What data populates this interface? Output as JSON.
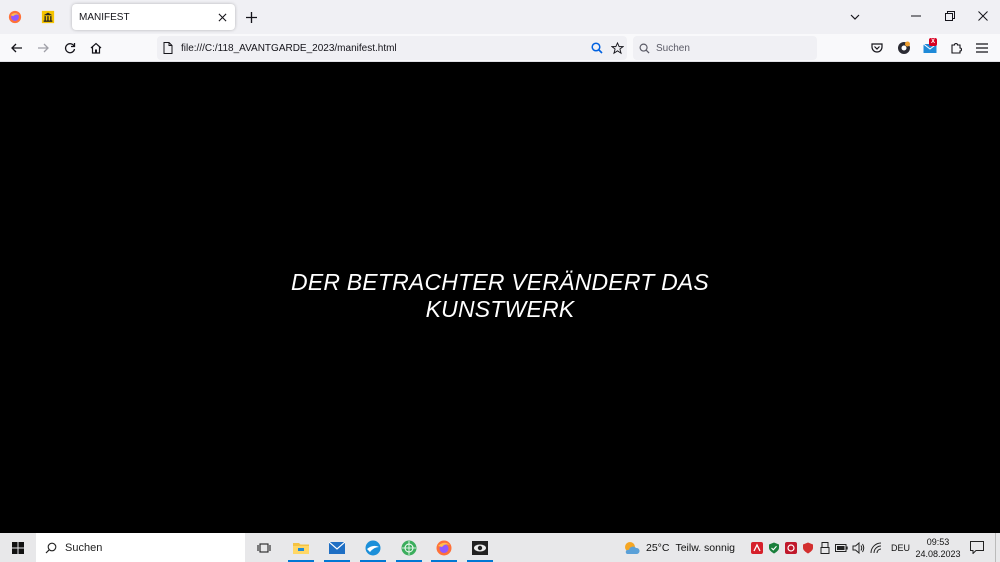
{
  "browser": {
    "tab_title": "MANIFEST",
    "url": "file:///C:/118_AVANTGARDE_2023/manifest.html",
    "search_placeholder": "Suchen"
  },
  "page": {
    "manifest_text": "DER BETRACHTER VERÄNDERT DAS KUNSTWERK",
    "background_color": "#000000",
    "text_color": "#ffffff"
  },
  "taskbar": {
    "search_placeholder": "Suchen",
    "weather_temp": "25°C",
    "weather_desc": "Teilw. sonnig",
    "language": "DEU",
    "time": "09:53",
    "date": "24.08.2023"
  },
  "icons": {
    "firefox": "firefox-icon",
    "museum": "museum-icon",
    "shield": "security-icon",
    "mail_badge": "X"
  },
  "colors": {
    "accent": "#0078d4",
    "firefox_orange": "#ff7139"
  }
}
